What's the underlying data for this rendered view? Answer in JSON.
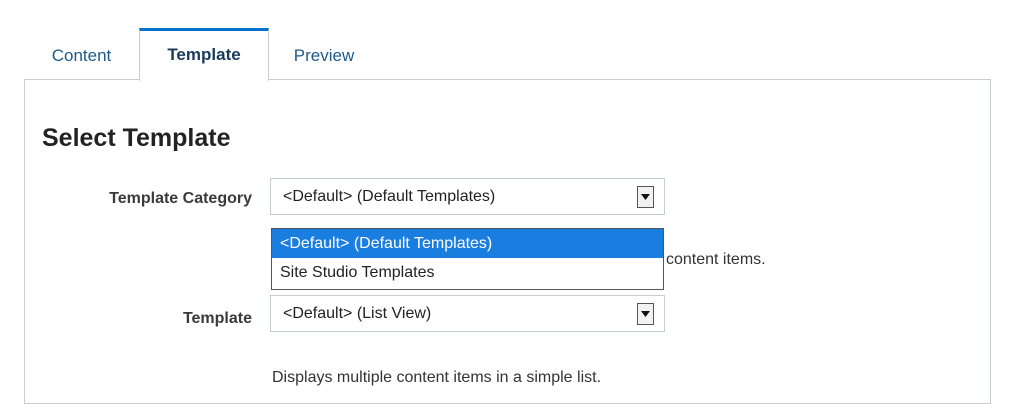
{
  "tabs": [
    {
      "label": "Content"
    },
    {
      "label": "Template"
    },
    {
      "label": "Preview"
    }
  ],
  "active_tab": "Template",
  "section_title": "Select Template",
  "template_category": {
    "label": "Template Category",
    "value": "<Default> (Default Templates)",
    "helper_visible": "content items.",
    "options": [
      "<Default> (Default Templates)",
      "Site Studio Templates"
    ],
    "highlighted_option": "<Default> (Default Templates)"
  },
  "template": {
    "label": "Template",
    "value": "<Default> (List View)",
    "helper": "Displays multiple content items in a simple list."
  },
  "icons": {
    "dropdown_arrow": "chevron-down-icon"
  },
  "colors": {
    "tab_accent": "#0572ce",
    "selected_option_bg": "#1a7de0",
    "link": "#1e5a8e"
  }
}
